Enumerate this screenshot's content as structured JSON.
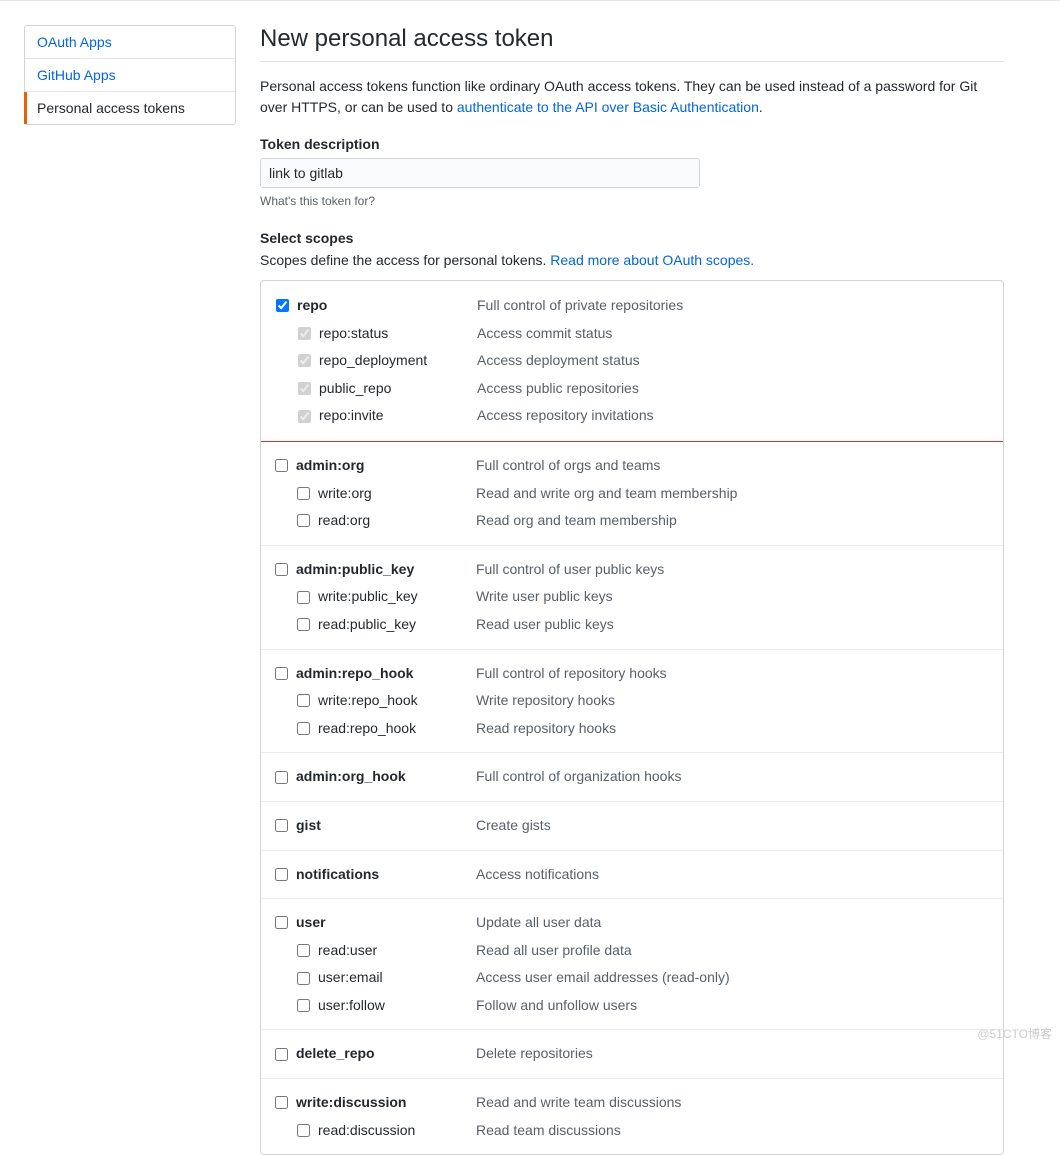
{
  "sidebar": {
    "items": [
      {
        "label": "OAuth Apps",
        "active": false
      },
      {
        "label": "GitHub Apps",
        "active": false
      },
      {
        "label": "Personal access tokens",
        "active": true
      }
    ]
  },
  "page": {
    "title": "New personal access token",
    "intro_before_link": "Personal access tokens function like ordinary OAuth access tokens. They can be used instead of a password for Git over HTTPS, or can be used to ",
    "intro_link": "authenticate to the API over Basic Authentication",
    "intro_after_link": "."
  },
  "token_description": {
    "label": "Token description",
    "value": "link to gitlab",
    "hint": "What's this token for?"
  },
  "scopes_section": {
    "label": "Select scopes",
    "desc_before_link": "Scopes define the access for personal tokens. ",
    "link": "Read more about OAuth scopes."
  },
  "scopes": [
    {
      "name": "repo",
      "desc": "Full control of private repositories",
      "checked": true,
      "highlight": true,
      "children": [
        {
          "name": "repo:status",
          "desc": "Access commit status",
          "checked": true
        },
        {
          "name": "repo_deployment",
          "desc": "Access deployment status",
          "checked": true
        },
        {
          "name": "public_repo",
          "desc": "Access public repositories",
          "checked": true
        },
        {
          "name": "repo:invite",
          "desc": "Access repository invitations",
          "checked": true
        }
      ]
    },
    {
      "name": "admin:org",
      "desc": "Full control of orgs and teams",
      "checked": false,
      "children": [
        {
          "name": "write:org",
          "desc": "Read and write org and team membership",
          "checked": false
        },
        {
          "name": "read:org",
          "desc": "Read org and team membership",
          "checked": false
        }
      ]
    },
    {
      "name": "admin:public_key",
      "desc": "Full control of user public keys",
      "checked": false,
      "children": [
        {
          "name": "write:public_key",
          "desc": "Write user public keys",
          "checked": false
        },
        {
          "name": "read:public_key",
          "desc": "Read user public keys",
          "checked": false
        }
      ]
    },
    {
      "name": "admin:repo_hook",
      "desc": "Full control of repository hooks",
      "checked": false,
      "children": [
        {
          "name": "write:repo_hook",
          "desc": "Write repository hooks",
          "checked": false
        },
        {
          "name": "read:repo_hook",
          "desc": "Read repository hooks",
          "checked": false
        }
      ]
    },
    {
      "name": "admin:org_hook",
      "desc": "Full control of organization hooks",
      "checked": false,
      "children": []
    },
    {
      "name": "gist",
      "desc": "Create gists",
      "checked": false,
      "children": []
    },
    {
      "name": "notifications",
      "desc": "Access notifications",
      "checked": false,
      "children": []
    },
    {
      "name": "user",
      "desc": "Update all user data",
      "checked": false,
      "children": [
        {
          "name": "read:user",
          "desc": "Read all user profile data",
          "checked": false
        },
        {
          "name": "user:email",
          "desc": "Access user email addresses (read-only)",
          "checked": false
        },
        {
          "name": "user:follow",
          "desc": "Follow and unfollow users",
          "checked": false
        }
      ]
    },
    {
      "name": "delete_repo",
      "desc": "Delete repositories",
      "checked": false,
      "children": []
    },
    {
      "name": "write:discussion",
      "desc": "Read and write team discussions",
      "checked": false,
      "children": [
        {
          "name": "read:discussion",
          "desc": "Read team discussions",
          "checked": false
        }
      ]
    }
  ],
  "watermark": "@51CTO博客"
}
